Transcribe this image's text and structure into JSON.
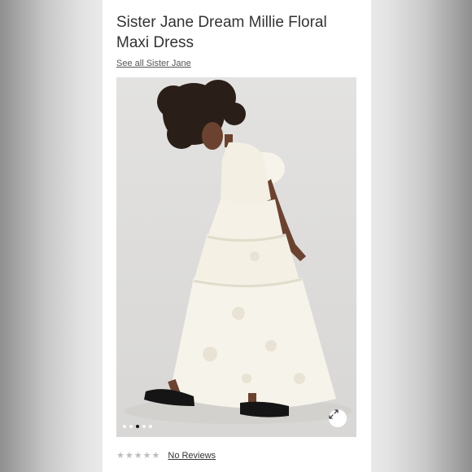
{
  "product": {
    "title": "Sister Jane Dream Millie Floral Maxi Dress",
    "brand_link": "See all Sister Jane"
  },
  "gallery": {
    "dot_count": 5,
    "active_index": 2,
    "expand_icon": "expand-arrows-icon",
    "image_alt": "Model wearing white floral maxi dress with puff sleeves and black loafers"
  },
  "rating": {
    "stars_filled": 0,
    "stars_total": 5,
    "reviews_label": "No Reviews"
  },
  "colors": {
    "card_bg": "#ffffff",
    "text": "#333333",
    "star_empty": "#bdbdbd",
    "dot_active": "#111111"
  }
}
